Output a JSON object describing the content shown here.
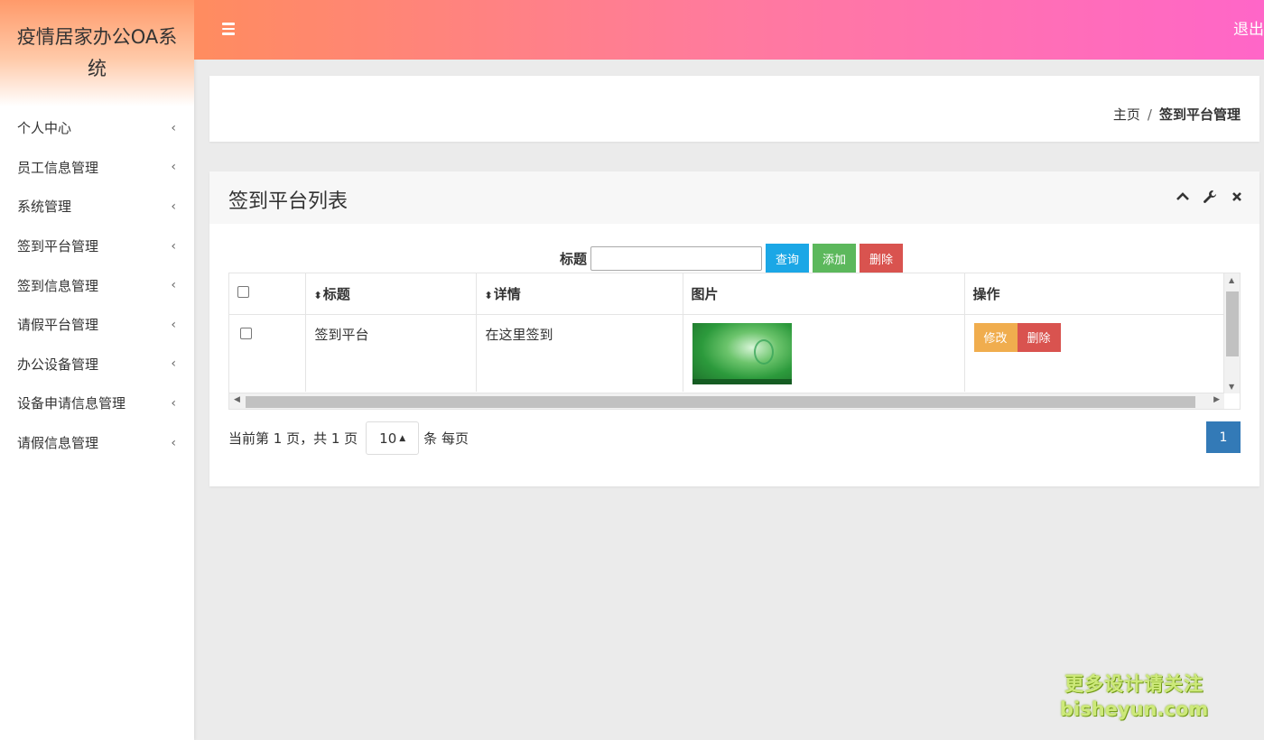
{
  "app": {
    "title": "疫情居家办公OA系统"
  },
  "sidebar": {
    "items": [
      {
        "label": "个人中心"
      },
      {
        "label": "员工信息管理"
      },
      {
        "label": "系统管理"
      },
      {
        "label": "签到平台管理"
      },
      {
        "label": "签到信息管理"
      },
      {
        "label": "请假平台管理"
      },
      {
        "label": "办公设备管理"
      },
      {
        "label": "设备申请信息管理"
      },
      {
        "label": "请假信息管理"
      }
    ],
    "chevron": "‹"
  },
  "header": {
    "logout": "退出",
    "menu_icon": "hamburger-icon",
    "gradient": [
      "#ff8c5f",
      "#ff66c8"
    ]
  },
  "breadcrumb": {
    "home": "主页",
    "separator": "/",
    "current": "签到平台管理"
  },
  "panel": {
    "title": "签到平台列表",
    "tools": [
      "collapse-icon",
      "wrench-icon",
      "close-icon"
    ]
  },
  "search": {
    "label": "标题",
    "value": "",
    "query_button": "查询",
    "add_button": "添加",
    "delete_button": "删除"
  },
  "table": {
    "columns": [
      "标题",
      "详情",
      "图片",
      "操作"
    ],
    "sort_icon": "⬍",
    "rows": [
      {
        "title": "签到平台",
        "detail": "在这里签到",
        "image": "green-thumbnail",
        "edit": "修改",
        "delete": "删除"
      }
    ]
  },
  "pagination": {
    "summary_prefix": "当前第 1 页，共 1 页",
    "page_size": "10",
    "page_size_suffix": "条 每页",
    "current_page": "1"
  },
  "watermark": {
    "line1": "更多设计请关注",
    "line2": "bisheyun.com"
  },
  "colors": {
    "primary_blue": "#1ba7e6",
    "success": "#5cb85c",
    "danger": "#d9534f",
    "warning": "#f0ad4e",
    "page_active": "#337ab7"
  }
}
